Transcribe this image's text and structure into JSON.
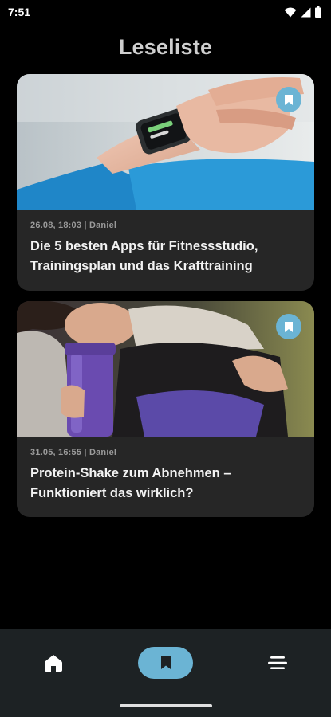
{
  "status_bar": {
    "time": "7:51"
  },
  "page": {
    "title": "Leseliste"
  },
  "articles": [
    {
      "meta": "26.08, 18:03 | Daniel",
      "title": "Die 5 besten Apps für Fitnessstudio, Trainingsplan und das Krafttraining",
      "bookmarked": true
    },
    {
      "meta": "31.05, 16:55 | Daniel",
      "title": "Protein-Shake zum Abnehmen – Funktioniert das wirklich?",
      "bookmarked": true
    }
  ],
  "bottom_nav": {
    "items": [
      {
        "icon": "home-icon",
        "active": false
      },
      {
        "icon": "bookmark-icon",
        "active": true
      },
      {
        "icon": "menu-icon",
        "active": false
      }
    ]
  },
  "colors": {
    "background": "#000000",
    "card": "#262626",
    "accent": "#6bb4d4",
    "nav_bar": "#1d2224"
  }
}
